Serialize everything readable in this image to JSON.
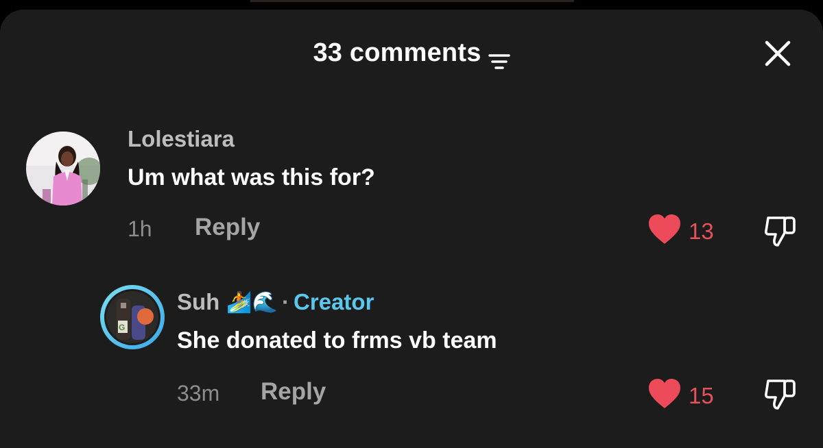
{
  "header": {
    "count_label": "33 comments"
  },
  "icons": {
    "filter": "filter-lines-icon",
    "close": "close-icon",
    "like": "heart-icon",
    "dislike": "thumbs-down-icon"
  },
  "colors": {
    "background": "#1c1c1c",
    "like": "#e8505b",
    "creator": "#5ac8ec",
    "text": "#ffffff",
    "muted": "#bdbdbd"
  },
  "comments": [
    {
      "username": "Lolestiara",
      "text": "Um what was this for?",
      "time": "1h",
      "reply_label": "Reply",
      "likes": "13"
    },
    {
      "username": "Suh",
      "username_emoji": "🏄🌊",
      "separator": "·",
      "badge": "Creator",
      "text": "She donated to frms vb team",
      "time": "33m",
      "reply_label": "Reply",
      "likes": "15"
    }
  ]
}
